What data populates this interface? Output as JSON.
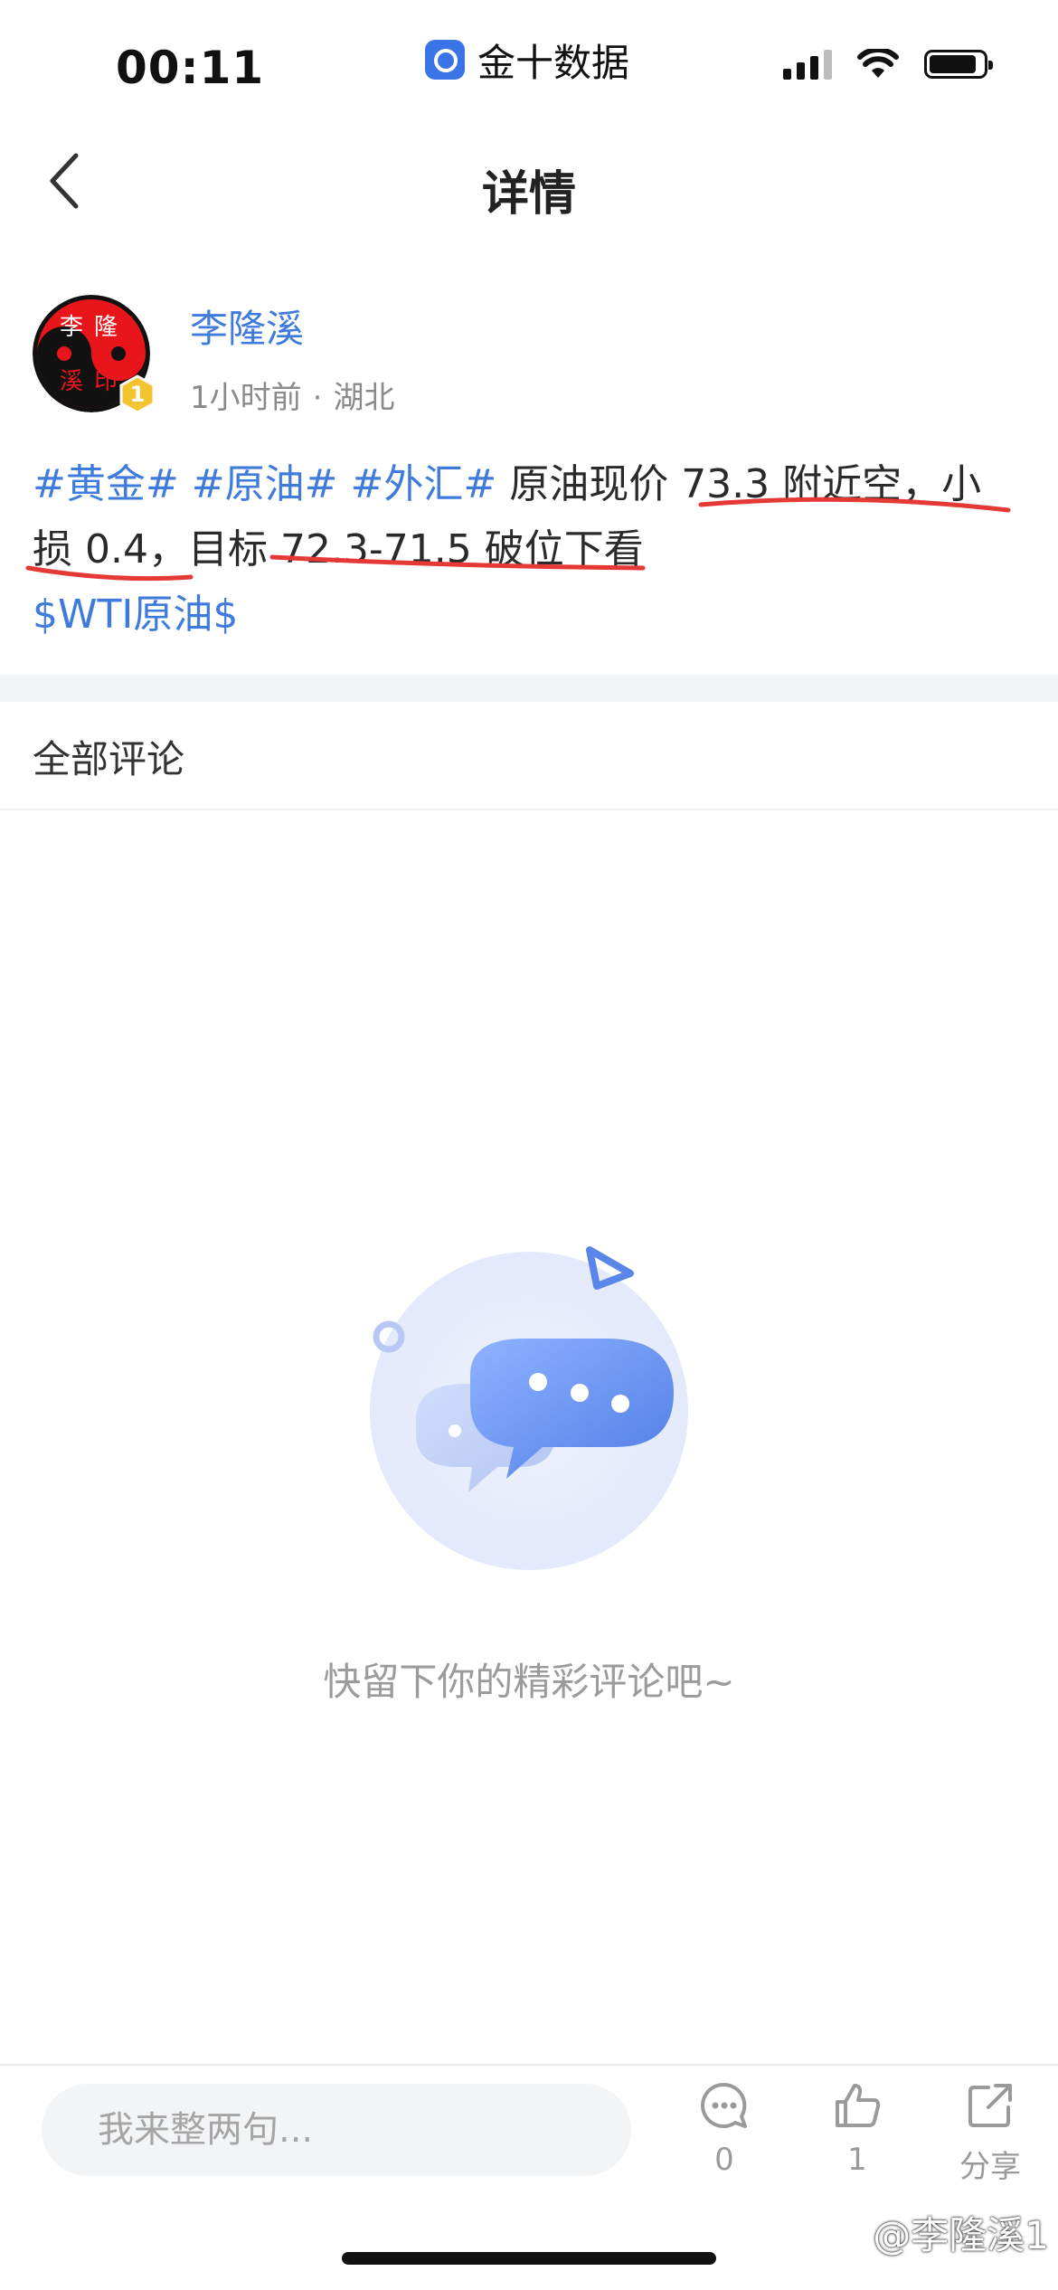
{
  "status_bar": {
    "time": "00:11",
    "app_name": "金十数据"
  },
  "nav": {
    "title": "详情"
  },
  "author": {
    "name": "李隆溪",
    "level": "1",
    "avatar_text": "李隆溪印",
    "time_ago": "1小时前",
    "separator": "·",
    "location": "湖北"
  },
  "post": {
    "tags": [
      "#黄金#",
      "#原油#",
      "#外汇#"
    ],
    "text_part1": "原油现价 73.3 附近空，小",
    "text_part2": "损 0.4，目标 72.3-71.5 破位下看",
    "stock_tag": "$WTI原油$"
  },
  "comments": {
    "header": "全部评论",
    "empty_text": "快留下你的精彩评论吧~"
  },
  "bottom_bar": {
    "input_placeholder": "我来整两句...",
    "comment_count": "0",
    "like_count": "1",
    "share_label": "分享"
  },
  "watermark": "@李隆溪1",
  "colors": {
    "accent_blue": "#3e7bdc",
    "annotation_red": "#e53935"
  }
}
